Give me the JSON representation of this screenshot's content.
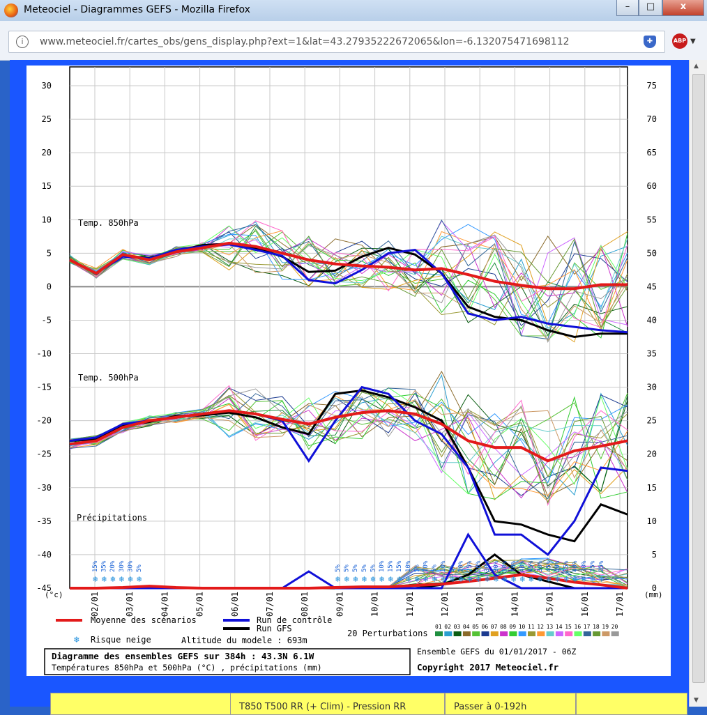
{
  "window": {
    "title": "Meteociel - Diagrammes GEFS - Mozilla Firefox",
    "min_label": "–",
    "max_label": "□",
    "close_label": "x"
  },
  "browser": {
    "url": "www.meteociel.fr/cartes_obs/gens_display.php?ext=1&lat=43.27935222672065&lon=-6.132075471698112",
    "abp_label": "ABP"
  },
  "bottom_tabs": [
    {
      "label": ""
    },
    {
      "label": "T850 T500 RR (+ Clim) - Pression RR"
    },
    {
      "label": "Passer à 0-192h"
    },
    {
      "label": ""
    }
  ],
  "chart_data": {
    "type": "line",
    "x_labels": [
      "02/01",
      "03/01",
      "04/01",
      "05/01",
      "06/01",
      "07/01",
      "08/01",
      "09/01",
      "10/01",
      "11/01",
      "12/01",
      "13/01",
      "14/01",
      "15/01",
      "16/01",
      "17/01"
    ],
    "y_left_ticks": [
      30,
      25,
      20,
      15,
      10,
      5,
      0,
      -5,
      -10,
      -15,
      -20,
      -25,
      -30,
      -35,
      -40,
      -45
    ],
    "y_right_ticks": [
      75,
      70,
      65,
      60,
      55,
      50,
      45,
      40,
      35,
      30,
      25,
      20,
      15,
      10,
      5,
      0
    ],
    "y_left_unit": "(°c)",
    "y_right_unit": "(mm)",
    "section_labels": {
      "t850": "Temp. 850hPa",
      "t500": "Temp. 500hPa",
      "precip": "Précipitations"
    },
    "snow_risk_left": [
      "15%",
      "35%",
      "20%",
      "30%",
      "30%",
      "5%"
    ],
    "snow_risk_right": [
      "5%",
      "5%",
      "5%",
      "5%",
      "5%",
      "10%",
      "15%",
      "15%",
      "10%",
      "5%",
      "10%",
      "5%",
      "10%",
      "5%",
      "10%",
      "25%",
      "20%",
      "30%",
      "30%",
      "30%",
      "30%",
      "40%",
      "45%",
      "30%",
      "45%",
      "40%",
      "35%",
      "40%",
      "30%",
      "35%",
      "25%"
    ],
    "series": [
      {
        "name": "Moyenne des scénarios",
        "color": "#e31a1a",
        "t850": [
          4,
          2,
          4.8,
          4,
          5.2,
          5.8,
          6.5,
          6,
          5,
          4,
          3.4,
          3.1,
          2.9,
          2.5,
          2.7,
          1.8,
          0.8,
          0.2,
          -0.3,
          -0.3,
          0.3,
          0.3
        ],
        "t500": [
          -23.5,
          -23,
          -21,
          -20,
          -19.5,
          -19,
          -18.5,
          -19,
          -19.8,
          -20.5,
          -19.5,
          -18.8,
          -18.5,
          -19,
          -20.5,
          -23,
          -24,
          -24,
          -26,
          -24.5,
          -23.8,
          -23
        ],
        "precip": [
          0,
          0,
          0.1,
          0.3,
          0.1,
          0,
          0,
          0,
          0,
          0,
          0.1,
          0.2,
          0.2,
          0.4,
          0.6,
          1,
          1.5,
          2,
          1.5,
          0.9,
          0.5,
          0
        ]
      },
      {
        "name": "Run de contrôle",
        "color": "#1010d8",
        "t850": [
          4,
          2,
          4.5,
          4.2,
          5.5,
          6,
          6.3,
          5.5,
          4.6,
          1,
          0.5,
          2.5,
          5,
          5.5,
          2,
          -4,
          -5,
          -4.5,
          -5.5,
          -6,
          -6.5,
          -6.8
        ],
        "t500": [
          -23,
          -22.5,
          -20.5,
          -20,
          -19.5,
          -19,
          -18.5,
          -19,
          -20,
          -26,
          -20,
          -15,
          -16,
          -20,
          -22,
          -27,
          -37,
          -37,
          -40,
          -35,
          -27,
          -27.5
        ],
        "precip": [
          0,
          0,
          0,
          0,
          0,
          0,
          0,
          0,
          0,
          2.5,
          0,
          0,
          0,
          0,
          0,
          8,
          2,
          0,
          0,
          0,
          0,
          0
        ]
      },
      {
        "name": "Run GFS",
        "color": "#000000",
        "t850": [
          4,
          2,
          4.6,
          4.3,
          5.3,
          6.2,
          6.4,
          5.8,
          4.5,
          2.2,
          2.4,
          4.5,
          5.8,
          4.8,
          2,
          -3,
          -4.5,
          -5,
          -6.5,
          -7.5,
          -7,
          -7
        ],
        "t500": [
          -23,
          -22.8,
          -20.7,
          -20.2,
          -19.3,
          -19.2,
          -18.8,
          -19.5,
          -21,
          -22,
          -16,
          -15.5,
          -16.5,
          -18,
          -20,
          -27,
          -35,
          -35.5,
          -37,
          -38,
          -32.5,
          -34
        ],
        "precip": [
          0,
          0,
          0,
          0,
          0,
          0,
          0,
          0,
          0,
          0,
          0,
          0,
          0,
          0,
          0.5,
          2,
          5,
          2,
          1,
          0,
          0,
          0
        ]
      }
    ],
    "perturbations_label": "20 Perturbations",
    "perturbation_ids": [
      "01",
      "02",
      "03",
      "04",
      "05",
      "06",
      "07",
      "08",
      "09",
      "10",
      "11",
      "12",
      "13",
      "14",
      "15",
      "16",
      "17",
      "18",
      "19",
      "20"
    ],
    "perturbation_colors": [
      "#1f8f3f",
      "#2a9fd0",
      "#0b5d12",
      "#8a6a2a",
      "#55c235",
      "#1b3a8f",
      "#e0a020",
      "#cc33cc",
      "#33cc33",
      "#3399ff",
      "#999933",
      "#ff9933",
      "#66cccc",
      "#cc66ff",
      "#ff66cc",
      "#66ff66",
      "#336699",
      "#669933",
      "#cc9966",
      "#999999"
    ],
    "legend": {
      "mean": "Moyenne des scénarios",
      "control": "Run de contrôle",
      "gfs": "Run GFS",
      "snow": "Risque neige",
      "altitude": "Altitude du modele : 693m"
    },
    "title": "Diagramme des ensembles GEFS sur 384h : 43.3N 6.1W",
    "subtitle": "Températures 850hPa et 500hPa (°C) , précipitations (mm)",
    "run_info": "Ensemble GEFS du 01/01/2017 - 06Z",
    "copyright": "Copyright 2017 Meteociel.fr"
  }
}
